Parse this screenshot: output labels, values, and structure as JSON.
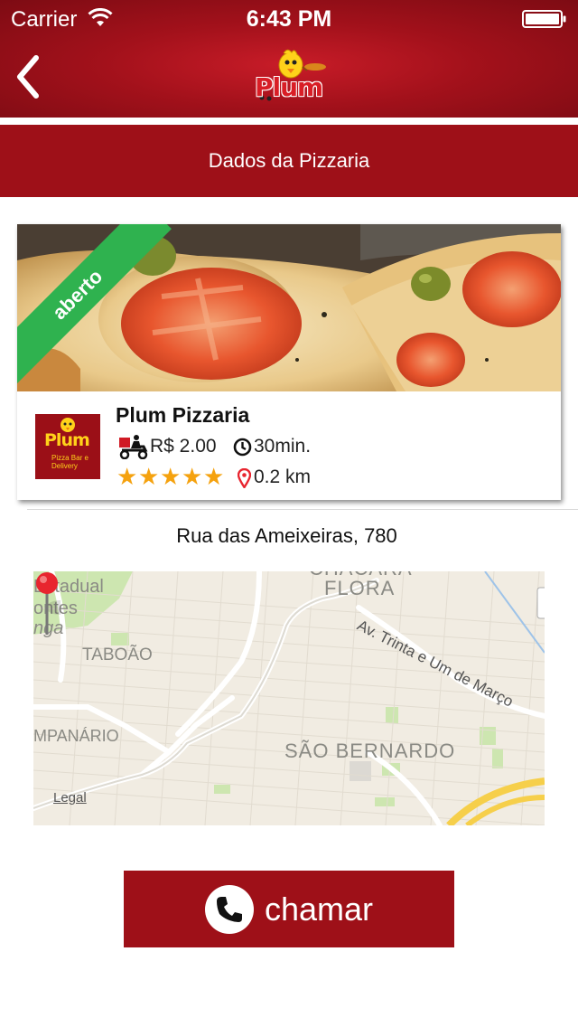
{
  "status_bar": {
    "carrier": "Carrier",
    "time": "6:43 PM"
  },
  "header": {
    "logo_text": "Plum",
    "back_icon": "chevron-left-icon"
  },
  "section": {
    "title": "Dados da Pizzaria"
  },
  "pizzeria": {
    "status_badge": "aberto",
    "name": "Plum Pizzaria",
    "logo_text": "Plum",
    "logo_subtext": "Pizza Bar e Delivery",
    "delivery_fee": "R$ 2.00",
    "delivery_time": "30min.",
    "rating": 5,
    "rating_max": 5,
    "distance": "0.2 km"
  },
  "address": "Rua das Ameixeiras, 780",
  "map": {
    "labels": {
      "estadual": "Estadual",
      "fontes": "ontes",
      "unga": "nga",
      "chacara": "CHÁCARA",
      "flora": "FLORA",
      "taboao": "TABOÃO",
      "avenue": "Av. Trinta e Um de Março",
      "campanario": "MPANÁRIO",
      "sao_bernardo": "SÃO BERNARDO",
      "legal": "Legal"
    }
  },
  "call_button": {
    "label": "chamar",
    "icon": "phone-icon"
  },
  "colors": {
    "brand": "#9e1018",
    "open_badge": "#2fb24f",
    "stars": "#f5a20f",
    "pin": "#e8252f"
  }
}
